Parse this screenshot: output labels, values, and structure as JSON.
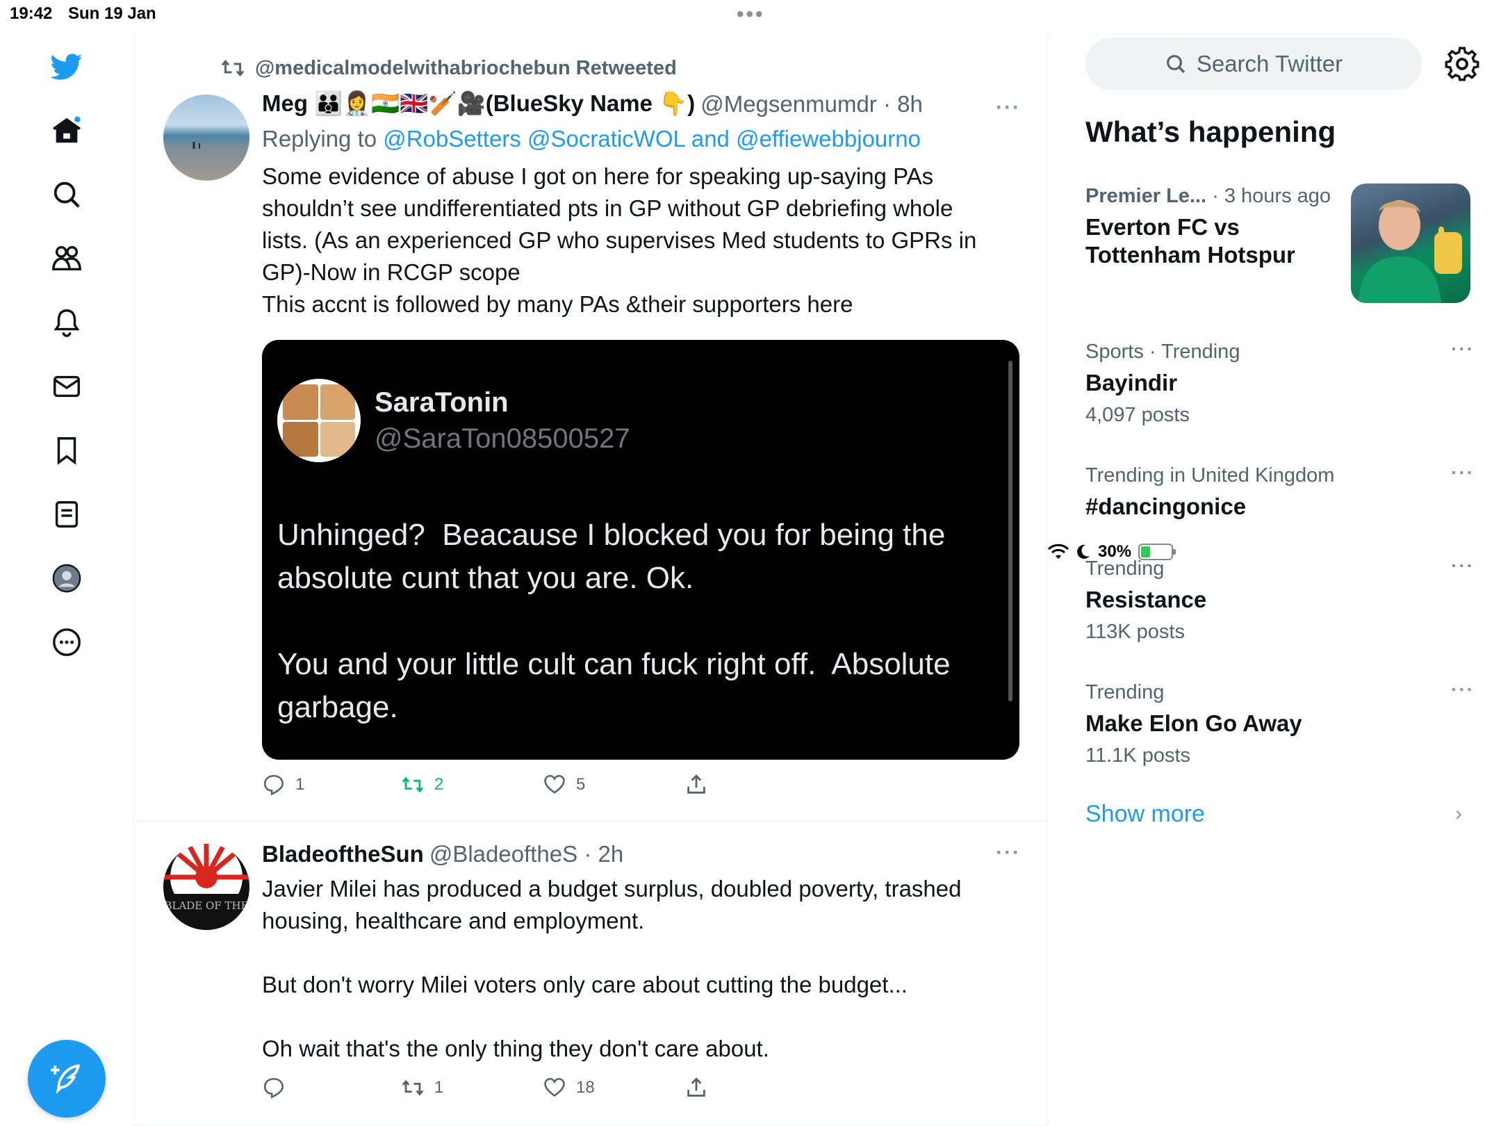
{
  "status_bar": {
    "time": "19:42",
    "date": "Sun 19 Jan",
    "battery": "30%"
  },
  "colors": {
    "accent": "#1d9bf0",
    "retweet_active": "#00ba7c",
    "secondary_text": "#536471"
  },
  "nav": {
    "icons": [
      "twitter-logo",
      "home-icon",
      "search-icon",
      "communities-icon",
      "notifications-icon",
      "messages-icon",
      "bookmarks-icon",
      "lists-icon",
      "profile-icon",
      "more-icon"
    ],
    "compose_icon": "compose-icon"
  },
  "tweets": [
    {
      "retweeted_by": "@medicalmodelwithabriochebun Retweeted",
      "name": "Meg 👪👩‍⚕️🇮🇳🇬🇧🏏🎥(BlueSky Name 👇)",
      "handle": "@Megsenmumdr · 8h",
      "replying_label": "Replying to",
      "replying_to": "@RobSetters @SocraticWOL and @effiewebbjourno",
      "text": "Some evidence of abuse I got on here for speaking up-saying PAs\nshouldn’t see undifferentiated pts in GP without GP debriefing whole\nlists. (As an experienced GP who supervises Med students to GPRs in\nGP)-Now in RCGP scope\nThis accnt is followed by many PAs &their supporters here",
      "embed": {
        "name": "SaraTonin",
        "handle": "@SaraTon08500527",
        "text": "Unhinged?  Beacause I blocked you for being the\nabsolute cunt that you are. Ok.\n\nYou and your little cult can fuck right off.  Absolute\ngarbage."
      },
      "replies": "1",
      "retweets": "2",
      "likes": "5"
    },
    {
      "name": "BladeoftheSun",
      "handle": "@BladeoftheS · 2h",
      "avatar_text": "BLADE OF THE",
      "text": "Javier Milei has produced a budget surplus, doubled poverty, trashed\nhousing, healthcare and employment.\n\nBut don't worry Milei voters only care about cutting the budget...\n\nOh wait that's the only thing they don't care about.",
      "replies": "",
      "retweets": "1",
      "likes": "18"
    }
  ],
  "sidebar": {
    "search_placeholder": "Search Twitter",
    "whats_happening": "What’s happening",
    "trends": [
      {
        "category": "Premier Le...",
        "time": " · 3 hours ago",
        "title": "Everton FC vs\nTottenham Hotspur",
        "posts": ""
      },
      {
        "category": "Sports · Trending",
        "title": "Bayindir",
        "posts": "4,097 posts"
      },
      {
        "category": "Trending in United Kingdom",
        "title": "#dancingonice",
        "posts": ""
      },
      {
        "category": "Trending",
        "title": "Resistance",
        "posts": "113K posts"
      },
      {
        "category": "Trending",
        "title": "Make Elon Go Away",
        "posts": "11.1K posts"
      }
    ],
    "show_more": "Show more"
  }
}
